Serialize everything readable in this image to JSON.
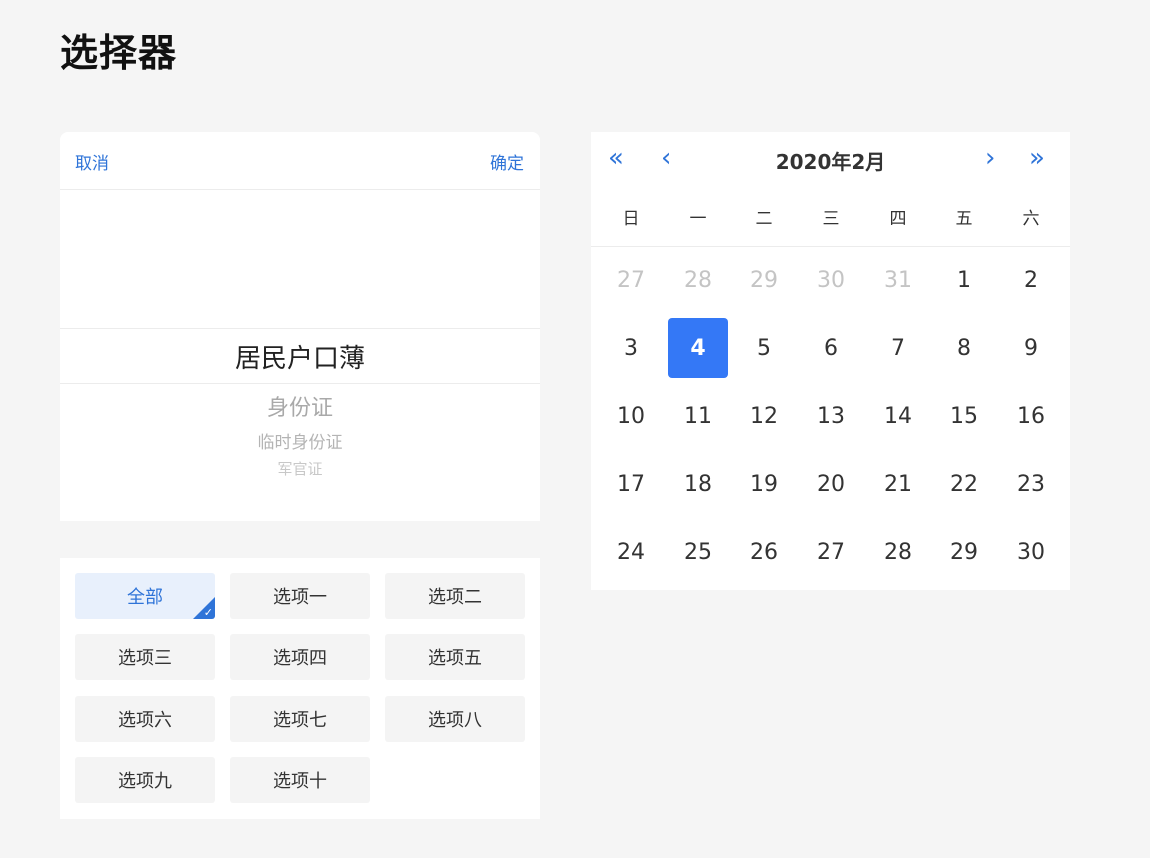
{
  "page_title": "选择器",
  "picker": {
    "cancel_label": "取消",
    "confirm_label": "确定",
    "selected": "居民户口薄",
    "options": [
      "身份证",
      "临时身份证",
      "军官证"
    ]
  },
  "option_grid": {
    "items": [
      "全部",
      "选项一",
      "选项二",
      "选项三",
      "选项四",
      "选项五",
      "选项六",
      "选项七",
      "选项八",
      "选项九",
      "选项十"
    ],
    "selected": "全部",
    "check_mark": "✓"
  },
  "calendar": {
    "title": "2020年2月",
    "nav": {
      "prev_year": "«",
      "prev_month": "‹",
      "next_month": "›",
      "next_year": "»"
    },
    "weekdays": [
      "日",
      "一",
      "二",
      "三",
      "四",
      "五",
      "六"
    ],
    "weeks": [
      [
        "27",
        "28",
        "29",
        "30",
        "31",
        "1",
        "2"
      ],
      [
        "3",
        "4",
        "5",
        "6",
        "7",
        "8",
        "9"
      ],
      [
        "10",
        "11",
        "12",
        "13",
        "14",
        "15",
        "16"
      ],
      [
        "17",
        "18",
        "19",
        "20",
        "21",
        "22",
        "23"
      ],
      [
        "24",
        "25",
        "26",
        "27",
        "28",
        "29",
        "30"
      ]
    ],
    "prev_month_days_count": 5,
    "selected_day": "4"
  },
  "colors": {
    "accent": "#2f74d8",
    "selected_day_bg": "#3478f6",
    "active_option_bg": "#e8f0fc"
  }
}
